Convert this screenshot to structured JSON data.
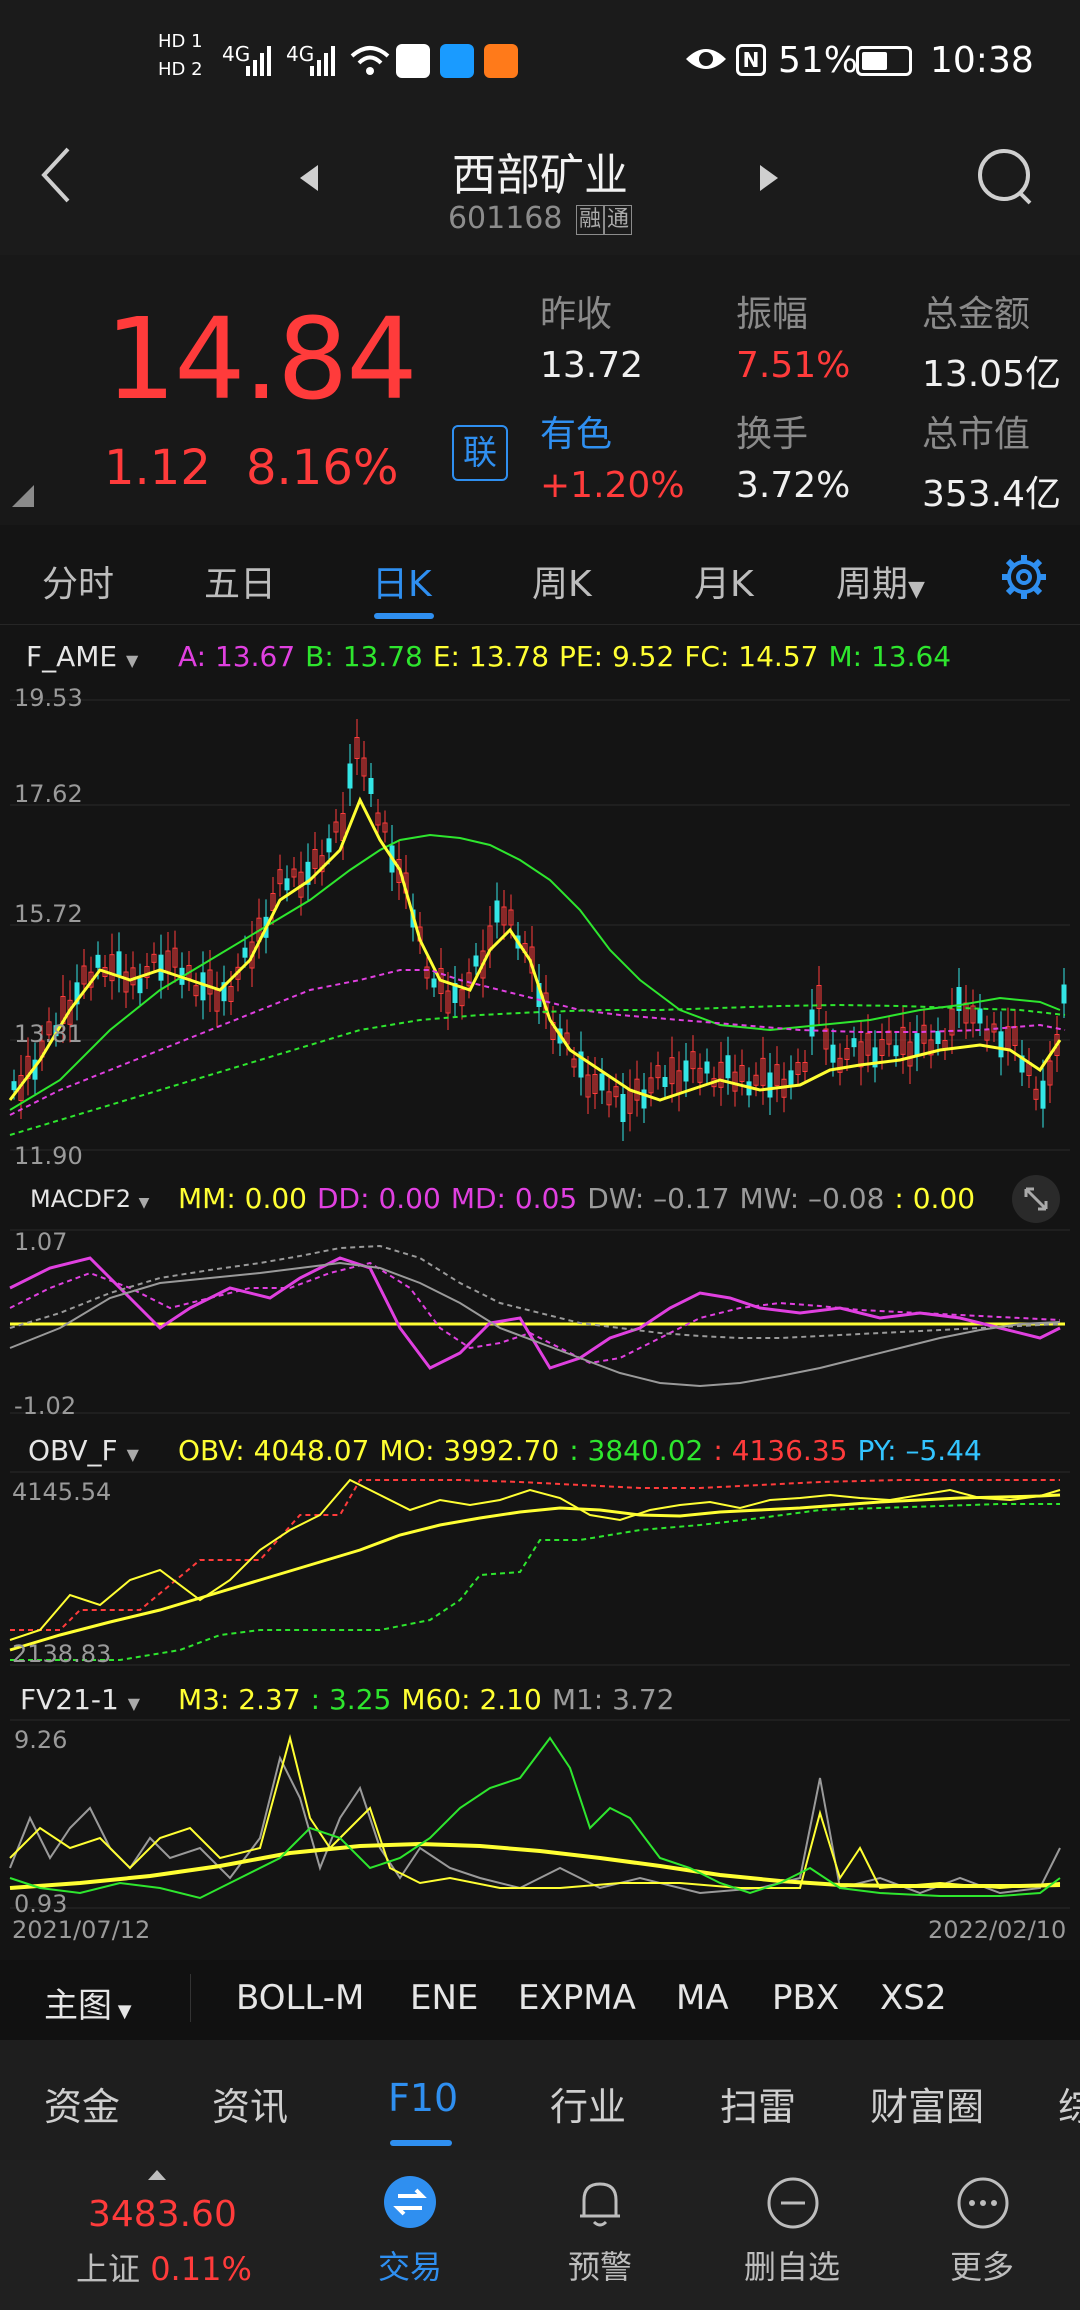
{
  "status": {
    "hd1": "HD 1",
    "hd2": "HD 2",
    "sig1": "4G",
    "sig2": "4G",
    "battery": "51%",
    "time": "10:38"
  },
  "header": {
    "title": "西部矿业",
    "code": "601168",
    "tag1": "融",
    "tag2": "通"
  },
  "quote": {
    "price": "14.84",
    "change": "1.12",
    "change_pct": "8.16%",
    "link_label": "联",
    "prev_close_label": "昨收",
    "prev_close": "13.72",
    "amplitude_label": "振幅",
    "amplitude": "7.51%",
    "amount_label": "总金额",
    "amount": "13.05亿",
    "sector_label": "有色",
    "sector_change": "+1.20%",
    "turnover_label": "换手",
    "turnover": "3.72%",
    "mcap_label": "总市值",
    "mcap": "353.4亿"
  },
  "tabs": [
    "分时",
    "五日",
    "日K",
    "周K",
    "月K",
    "周期"
  ],
  "main_chart": {
    "indicator": "F_AME",
    "params": [
      {
        "label": "A: 13.67",
        "color": "#e040e0"
      },
      {
        "label": "B: 13.78",
        "color": "#2ee62e"
      },
      {
        "label": "E: 13.78",
        "color": "#ffff33"
      },
      {
        "label": "PE: 9.52",
        "color": "#ffff33"
      },
      {
        "label": "FC: 14.57",
        "color": "#ffff33"
      },
      {
        "label": "M: 13.64",
        "color": "#2ee62e"
      }
    ],
    "y_labels": [
      "19.53",
      "17.62",
      "15.72",
      "13.81",
      "11.90"
    ]
  },
  "macd": {
    "indicator": "MACDF2",
    "params": [
      {
        "label": "MM: 0.00",
        "color": "#ffff33"
      },
      {
        "label": "DD: 0.00",
        "color": "#e040e0"
      },
      {
        "label": "MD: 0.05",
        "color": "#e040e0"
      },
      {
        "label": "DW: –0.17",
        "color": "#9a9a9a"
      },
      {
        "label": "MW: –0.08",
        "color": "#9a9a9a"
      },
      {
        "label": ": 0.00",
        "color": "#ffff33"
      }
    ],
    "y_labels": [
      "1.07",
      "-1.02"
    ]
  },
  "obv": {
    "indicator": "OBV_F",
    "params": [
      {
        "label": "OBV: 4048.07",
        "color": "#ffff33"
      },
      {
        "label": "MO: 3992.70",
        "color": "#ffff33"
      },
      {
        "label": ": 3840.02",
        "color": "#2ee62e"
      },
      {
        "label": ": 4136.35",
        "color": "#ff3b3b"
      },
      {
        "label": "PY: –5.44",
        "color": "#33c4ff"
      }
    ],
    "y_labels": [
      "4145.54",
      "2138.83"
    ]
  },
  "fv": {
    "indicator": "FV21-1",
    "params": [
      {
        "label": "M3: 2.37",
        "color": "#ffff33"
      },
      {
        "label": ": 3.25",
        "color": "#2ee62e"
      },
      {
        "label": "M60: 2.10",
        "color": "#ffff33"
      },
      {
        "label": "M1: 3.72",
        "color": "#9a9a9a"
      }
    ],
    "y_labels": [
      "9.26",
      "0.93"
    ],
    "date_start": "2021/07/12",
    "date_end": "2022/02/10"
  },
  "indicator_bar": {
    "main": "主图",
    "items": [
      "BOLL-M",
      "ENE",
      "EXPMA",
      "MA",
      "PBX",
      "XS2"
    ]
  },
  "bottom_tabs": [
    "资金",
    "资讯",
    "F10",
    "行业",
    "扫雷",
    "财富圈",
    "综"
  ],
  "nav": {
    "index_value": "3483.60",
    "index_name": "上证",
    "index_pct": "0.11%",
    "items": [
      "交易",
      "预警",
      "删自选",
      "更多"
    ]
  }
}
